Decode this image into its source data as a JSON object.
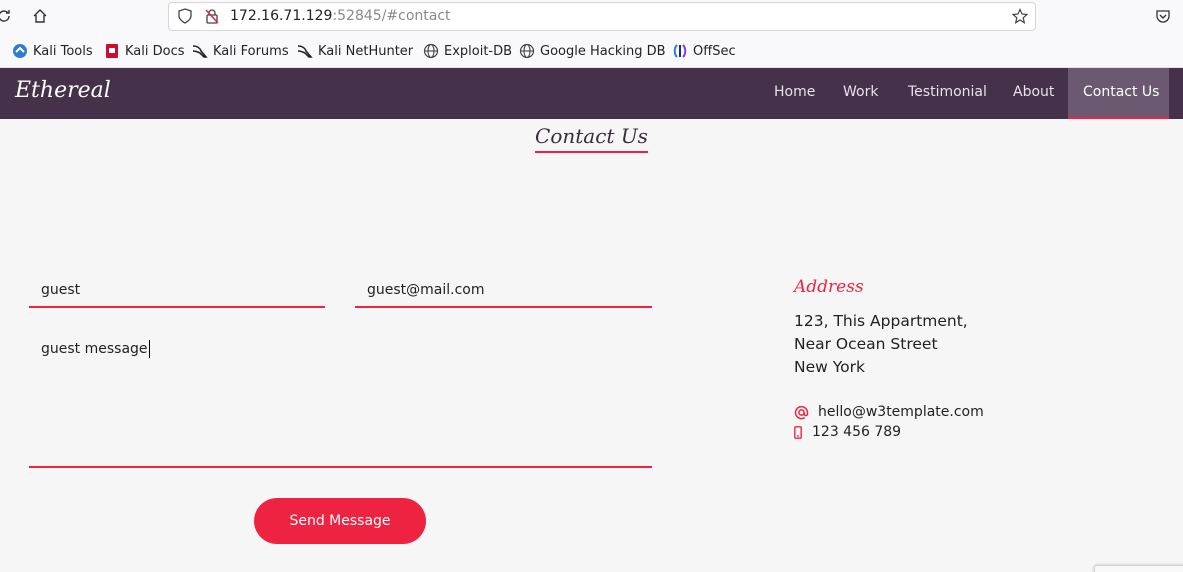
{
  "browser": {
    "url_host": "172.16.71.129",
    "url_rest": ":52845/#contact",
    "bookmarks": [
      "Kali Tools",
      "Kali Docs",
      "Kali Forums",
      "Kali NetHunter",
      "Exploit-DB",
      "Google Hacking DB",
      "OffSec"
    ]
  },
  "site": {
    "brand": "Ethereal",
    "nav": [
      "Home",
      "Work",
      "Testimonial",
      "About",
      "Contact Us"
    ],
    "active_nav": "Contact Us"
  },
  "contact": {
    "title": "Contact Us",
    "name_value": "guest",
    "email_value": "guest@mail.com",
    "message_value": "guest message",
    "send_label": "Send Message"
  },
  "address": {
    "title": "Address",
    "lines": [
      "123, This Appartment,",
      "Near Ocean Street",
      "New York"
    ],
    "email": "hello@w3template.com",
    "phone": "123 456 789"
  },
  "colors": {
    "accent": "#ee2342",
    "nav_bg": "#45324a",
    "active_nav_bg": "#6a5970"
  }
}
